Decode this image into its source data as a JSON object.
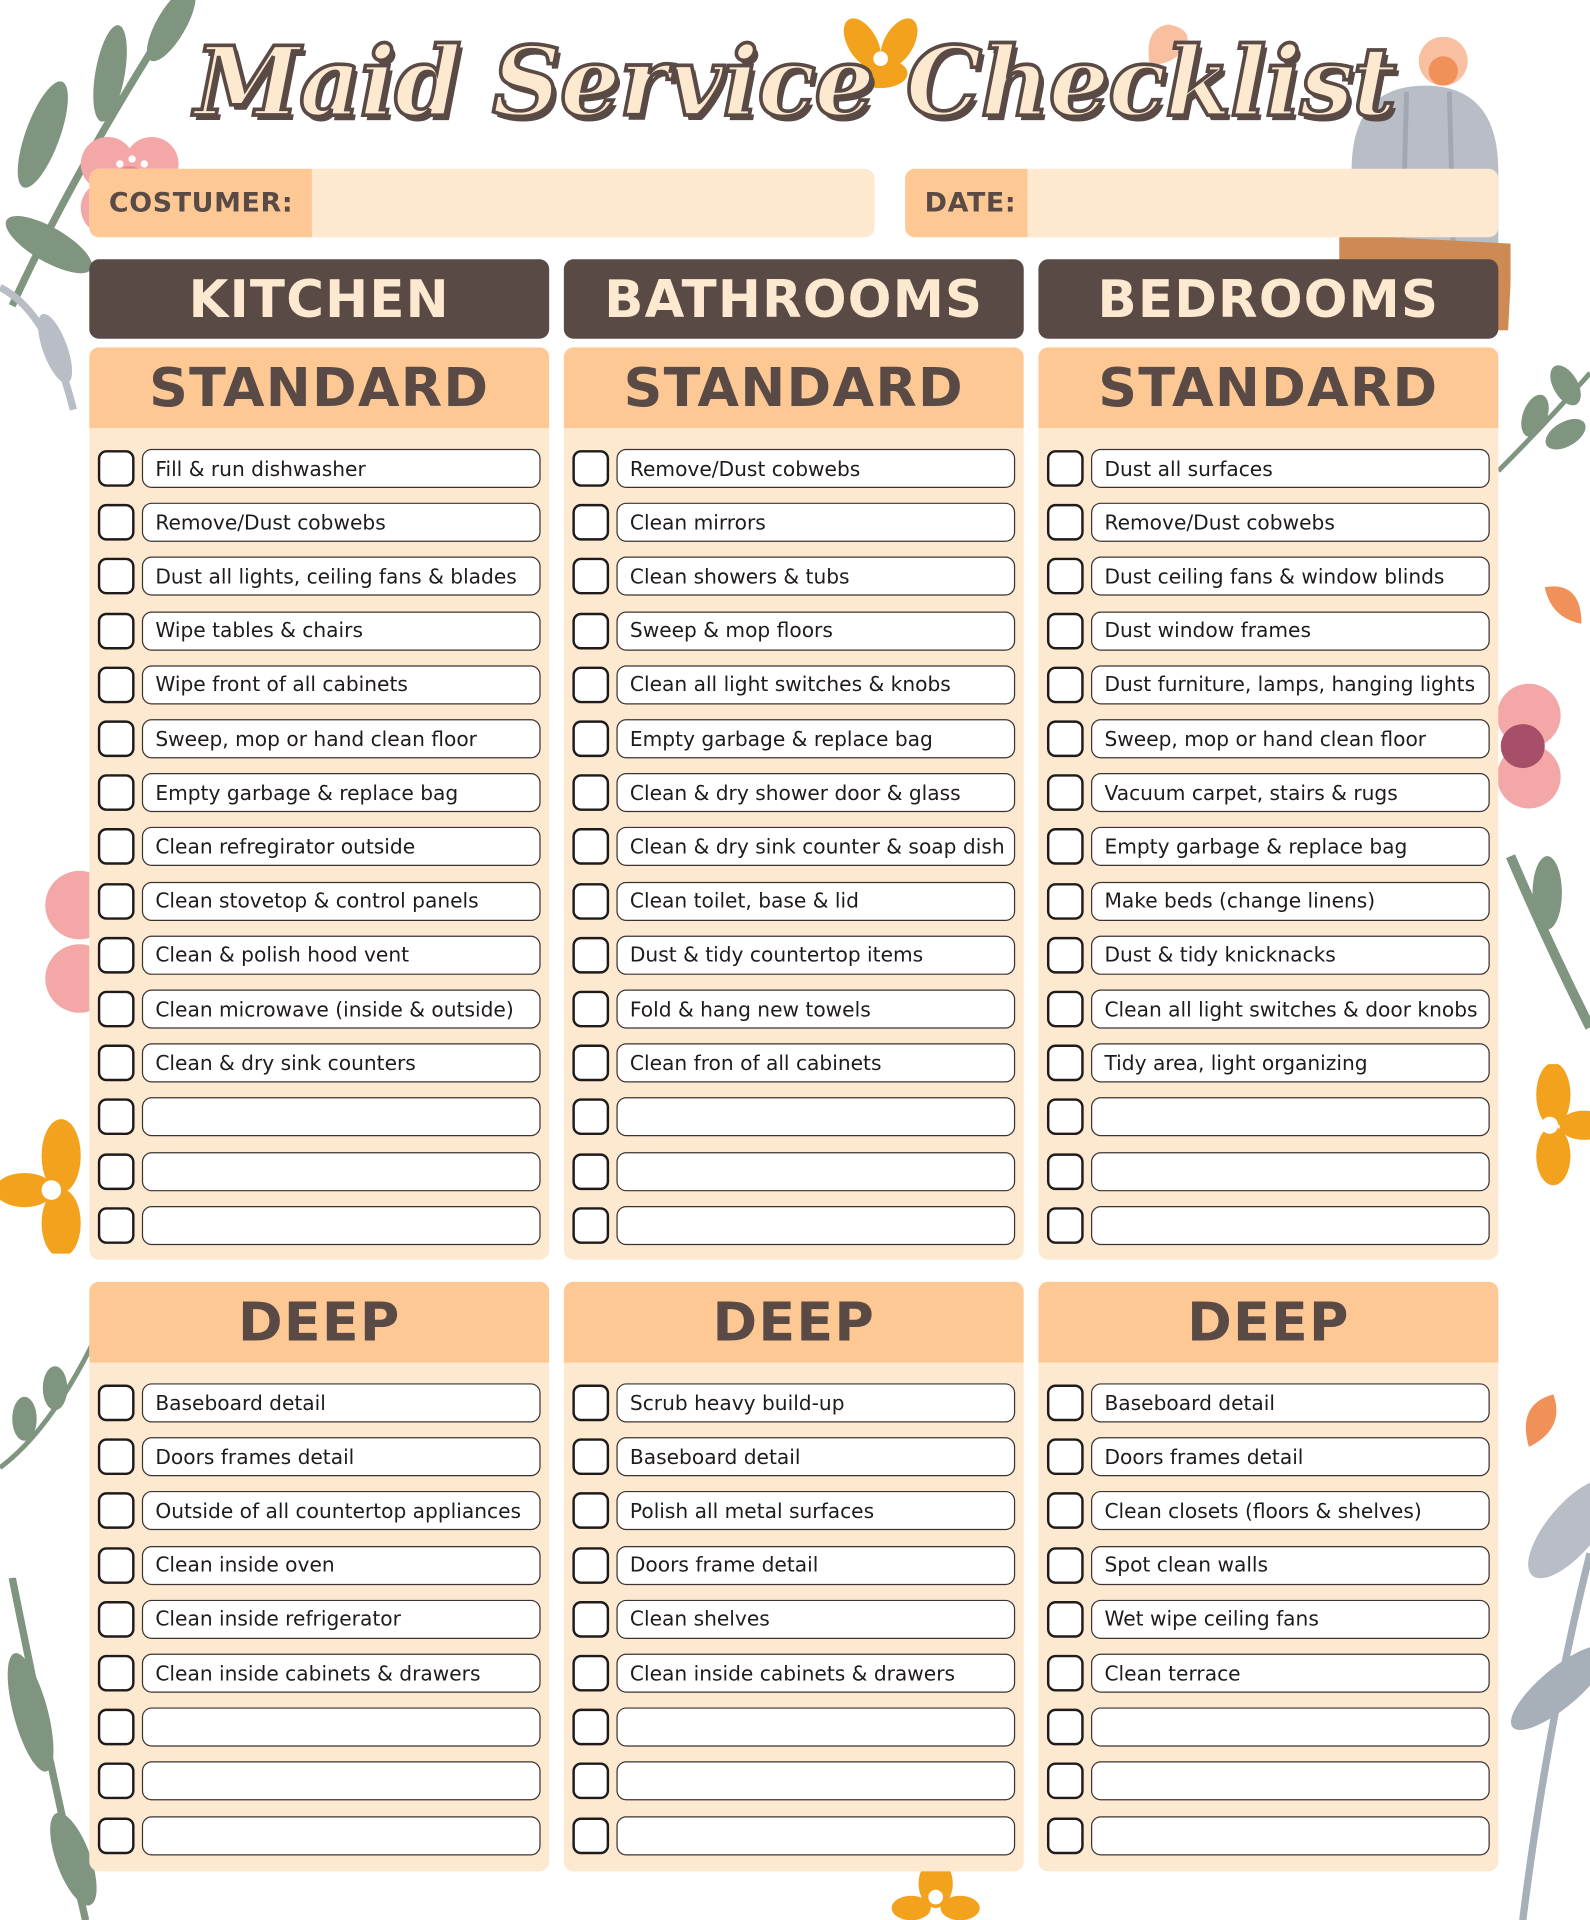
{
  "title": "Maid Service Checklist",
  "fields": {
    "customer": {
      "label": "COSTUMER:",
      "value": ""
    },
    "date": {
      "label": "DATE:",
      "value": ""
    }
  },
  "colors": {
    "dark_brown": "#5a4a46",
    "peach": "#fdc893",
    "cream": "#fde8d0",
    "sage_leaf": "#7f9580",
    "orange_flower": "#f2a21c",
    "pink_flower": "#f4a7a7",
    "gray_cactus": "#b9bec6"
  },
  "columns": [
    {
      "room": "KITCHEN",
      "standard": {
        "heading": "STANDARD",
        "items": [
          "Fill & run dishwasher",
          "Remove/Dust cobwebs",
          "Dust all lights, ceiling fans & blades",
          "Wipe tables & chairs",
          "Wipe front of all cabinets",
          "Sweep, mop or hand clean floor",
          "Empty garbage & replace bag",
          "Clean refregirator outside",
          "Clean stovetop & control panels",
          "Clean & polish hood vent",
          "Clean microwave (inside & outside)",
          "Clean & dry sink counters",
          "",
          "",
          ""
        ]
      },
      "deep": {
        "heading": "DEEP",
        "items": [
          "Baseboard detail",
          "Doors frames detail",
          "Outside of all countertop appliances",
          "Clean inside oven",
          "Clean inside refrigerator",
          "Clean inside cabinets & drawers",
          "",
          "",
          ""
        ]
      }
    },
    {
      "room": "BATHROOMS",
      "standard": {
        "heading": "STANDARD",
        "items": [
          "Remove/Dust cobwebs",
          "Clean mirrors",
          "Clean showers & tubs",
          "Sweep & mop floors",
          "Clean all light switches & knobs",
          "Empty garbage & replace bag",
          "Clean & dry shower door & glass",
          "Clean & dry sink counter & soap dish",
          "Clean toilet, base & lid",
          "Dust & tidy countertop items",
          "Fold & hang new towels",
          "Clean fron of all cabinets",
          "",
          "",
          ""
        ]
      },
      "deep": {
        "heading": "DEEP",
        "items": [
          "Scrub heavy build-up",
          "Baseboard detail",
          "Polish all metal surfaces",
          "Doors frame detail",
          "Clean shelves",
          "Clean inside cabinets & drawers",
          "",
          "",
          ""
        ]
      }
    },
    {
      "room": "BEDROOMS",
      "standard": {
        "heading": "STANDARD",
        "items": [
          "Dust all surfaces",
          "Remove/Dust cobwebs",
          "Dust ceiling fans & window blinds",
          "Dust window frames",
          "Dust furniture, lamps, hanging lights",
          "Sweep, mop or hand clean floor",
          "Vacuum carpet, stairs & rugs",
          "Empty garbage & replace bag",
          "Make beds (change linens)",
          "Dust & tidy knicknacks",
          "Clean all light switches & door knobs",
          "Tidy area, light organizing",
          "",
          "",
          ""
        ]
      },
      "deep": {
        "heading": "DEEP",
        "items": [
          "Baseboard detail",
          "Doors frames detail",
          "Clean closets (floors & shelves)",
          "Spot clean walls",
          "Wet wipe ceiling fans",
          "Clean terrace",
          "",
          "",
          ""
        ]
      }
    }
  ]
}
